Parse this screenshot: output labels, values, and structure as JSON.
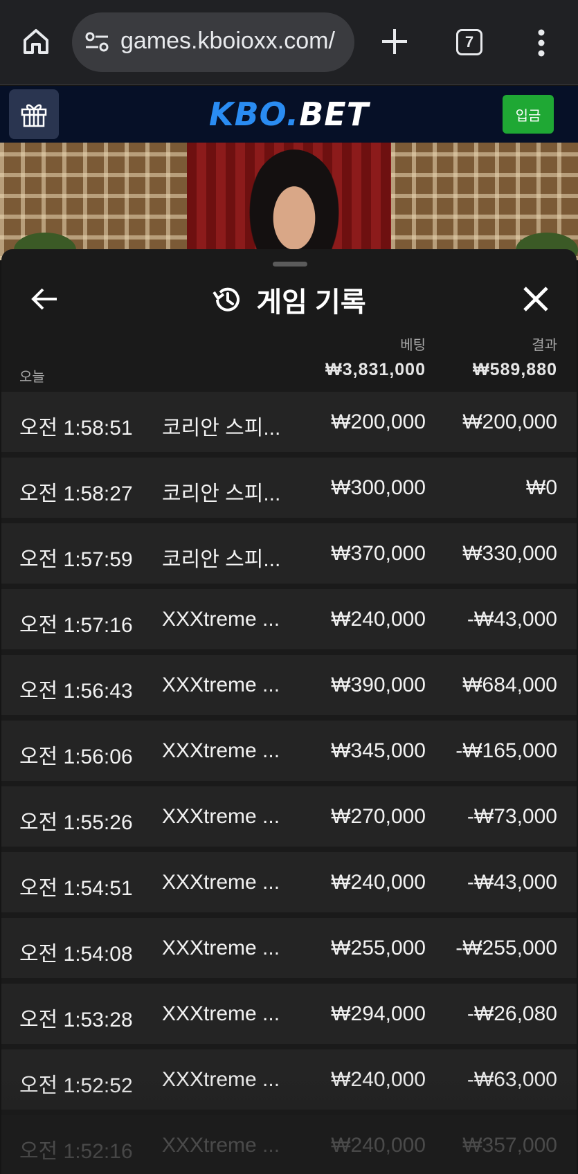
{
  "browser": {
    "url": "games.kboioxx.com/",
    "tab_count": "7"
  },
  "site": {
    "logo_part1": "KBO.",
    "logo_part2": "BET",
    "deposit_label": "입금"
  },
  "sheet": {
    "title": "게임 기록",
    "col_bet": "베팅",
    "col_result": "결과",
    "period_label": "오늘",
    "total_bet": "₩3,831,000",
    "total_result": "₩589,880"
  },
  "history": [
    {
      "time": "오전 1:58:51",
      "game": "코리안 스피...",
      "bet": "₩200,000",
      "result": "₩200,000"
    },
    {
      "time": "오전 1:58:27",
      "game": "코리안 스피...",
      "bet": "₩300,000",
      "result": "₩0"
    },
    {
      "time": "오전 1:57:59",
      "game": "코리안 스피...",
      "bet": "₩370,000",
      "result": "₩330,000"
    },
    {
      "time": "오전 1:57:16",
      "game": "XXXtreme ...",
      "bet": "₩240,000",
      "result": "-₩43,000"
    },
    {
      "time": "오전 1:56:43",
      "game": "XXXtreme ...",
      "bet": "₩390,000",
      "result": "₩684,000"
    },
    {
      "time": "오전 1:56:06",
      "game": "XXXtreme ...",
      "bet": "₩345,000",
      "result": "-₩165,000"
    },
    {
      "time": "오전 1:55:26",
      "game": "XXXtreme ...",
      "bet": "₩270,000",
      "result": "-₩73,000"
    },
    {
      "time": "오전 1:54:51",
      "game": "XXXtreme ...",
      "bet": "₩240,000",
      "result": "-₩43,000"
    },
    {
      "time": "오전 1:54:08",
      "game": "XXXtreme ...",
      "bet": "₩255,000",
      "result": "-₩255,000"
    },
    {
      "time": "오전 1:53:28",
      "game": "XXXtreme ...",
      "bet": "₩294,000",
      "result": "-₩26,080"
    },
    {
      "time": "오전 1:52:52",
      "game": "XXXtreme ...",
      "bet": "₩240,000",
      "result": "-₩63,000"
    },
    {
      "time": "오전 1:52:16",
      "game": "XXXtreme ...",
      "bet": "₩240,000",
      "result": "₩357,000"
    }
  ],
  "colors": {
    "deposit_green": "#1fa834",
    "logo_blue": "#2a8cf2",
    "header_navy": "#061027"
  }
}
